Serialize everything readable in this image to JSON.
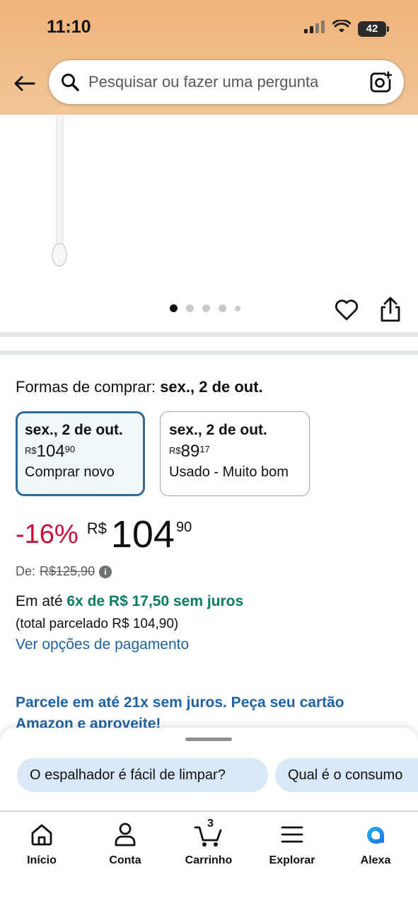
{
  "status": {
    "time": "11:10",
    "battery": "42"
  },
  "search": {
    "placeholder": "Pesquisar ou fazer uma pergunta"
  },
  "gallery": {
    "dot_count": 5,
    "active_index": 0
  },
  "buying": {
    "title_prefix": "Formas de comprar:",
    "title_date": "sex., 2 de out.",
    "options": [
      {
        "date": "sex., 2 de out.",
        "currency": "R$",
        "price_main": "104",
        "price_cents": "90",
        "condition": "Comprar novo"
      },
      {
        "date": "sex., 2 de out.",
        "currency": "R$",
        "price_main": "89",
        "price_cents": "17",
        "condition": "Usado - Muito bom"
      }
    ]
  },
  "price": {
    "discount": "-16%",
    "currency": "R$",
    "main": "104",
    "cents": "90",
    "list_label": "De:",
    "list_price": "R$125,90"
  },
  "installments": {
    "prefix": "Em até",
    "highlight": "6x de R$ 17,50 sem juros",
    "total": "(total parcelado R$ 104,90)",
    "link": "Ver opções de pagamento"
  },
  "promo": {
    "text": "Parcele em até 21x sem juros. Peça seu cartão Amazon e aproveite!"
  },
  "sheet": {
    "chips": [
      "O espalhador é fácil de limpar?",
      "Qual é o consumo"
    ]
  },
  "nav": {
    "items": [
      {
        "label": "Início"
      },
      {
        "label": "Conta"
      },
      {
        "label": "Carrinho",
        "count": "3"
      },
      {
        "label": "Explorar"
      },
      {
        "label": "Alexa"
      }
    ]
  },
  "colors": {
    "accent": "#2162a1",
    "discount": "#cc0c39",
    "installment": "#067d62",
    "selected_border": "#2f6a98",
    "chip": "#d8e8f6"
  }
}
